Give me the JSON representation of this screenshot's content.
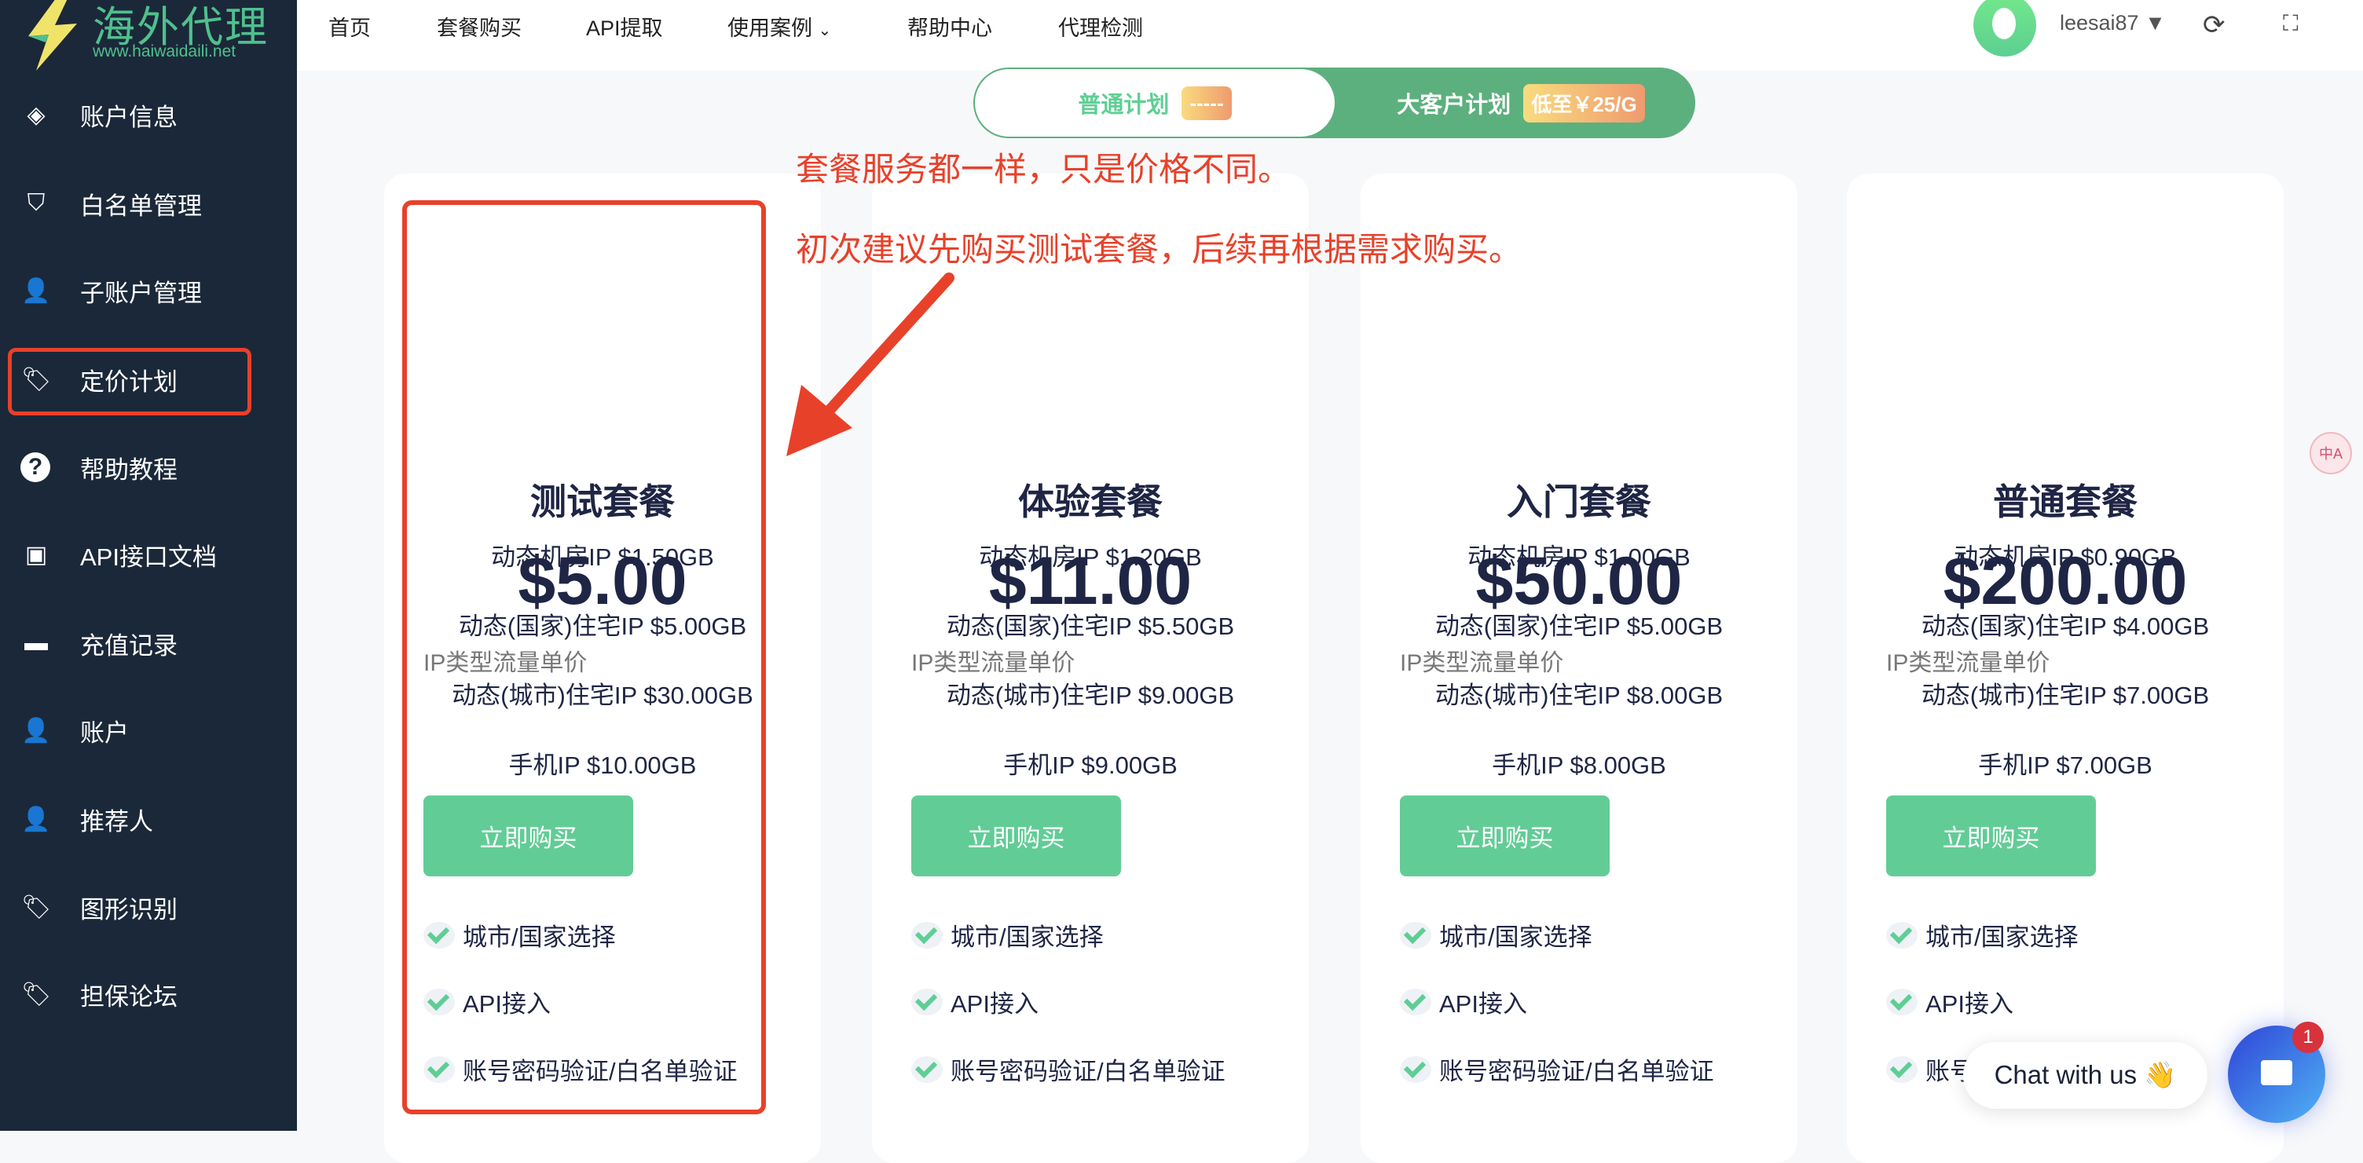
{
  "logo": {
    "name": "海外代理",
    "url": "www.haiwaidaili.net"
  },
  "nav": [
    "首页",
    "套餐购买",
    "API提取",
    "使用案例",
    "帮助中心",
    "代理检测"
  ],
  "user": {
    "name": "leesai87"
  },
  "sidebar": {
    "items": [
      {
        "label": "账户信息",
        "icon": "layers-icon"
      },
      {
        "label": "白名单管理",
        "icon": "shield-icon"
      },
      {
        "label": "子账户管理",
        "icon": "user-gear-icon"
      },
      {
        "label": "定价计划",
        "icon": "tag-icon"
      },
      {
        "label": "帮助教程",
        "icon": "question-icon"
      },
      {
        "label": "API接口文档",
        "icon": "cube-icon"
      },
      {
        "label": "充值记录",
        "icon": "wallet-icon"
      },
      {
        "label": "账户",
        "icon": "user-card-icon"
      },
      {
        "label": "推荐人",
        "icon": "user-share-icon"
      },
      {
        "label": "图形识别",
        "icon": "tag-icon"
      },
      {
        "label": "担保论坛",
        "icon": "tag-icon"
      }
    ],
    "active": 3
  },
  "plans_toggle": {
    "normal": "普通计划",
    "normal_tag": "-----",
    "enterprise": "大客户计划",
    "enterprise_tag": "低至￥25/G"
  },
  "annotations": [
    "套餐服务都一样，只是价格不同。",
    "初次建议先购买测试套餐，后续再根据需求购买。"
  ],
  "cards": [
    {
      "title": "测试套餐",
      "price": "$5.00",
      "subtitle": "IP类型流量单价",
      "lines": [
        "动态机房IP $1.50GB",
        "动态(国家)住宅IP $5.00GB",
        "动态(城市)住宅IP $30.00GB",
        "手机IP $10.00GB"
      ],
      "button": "立即购买",
      "features": [
        "城市/国家选择",
        "API接入",
        "账号密码验证/白名单验证"
      ]
    },
    {
      "title": "体验套餐",
      "price": "$11.00",
      "subtitle": "IP类型流量单价",
      "lines": [
        "动态机房IP $1.20GB",
        "动态(国家)住宅IP $5.50GB",
        "动态(城市)住宅IP $9.00GB",
        "手机IP $9.00GB"
      ],
      "button": "立即购买",
      "features": [
        "城市/国家选择",
        "API接入",
        "账号密码验证/白名单验证"
      ]
    },
    {
      "title": "入门套餐",
      "price": "$50.00",
      "subtitle": "IP类型流量单价",
      "lines": [
        "动态机房IP $1.00GB",
        "动态(国家)住宅IP $5.00GB",
        "动态(城市)住宅IP $8.00GB",
        "手机IP $8.00GB"
      ],
      "button": "立即购买",
      "features": [
        "城市/国家选择",
        "API接入",
        "账号密码验证/白名单验证"
      ]
    },
    {
      "title": "普通套餐",
      "price": "$200.00",
      "subtitle": "IP类型流量单价",
      "lines": [
        "动态机房IP $0.90GB",
        "动态(国家)住宅IP $4.00GB",
        "动态(城市)住宅IP $7.00GB",
        "手机IP $7.00GB"
      ],
      "button": "立即购买",
      "features": [
        "城市/国家选择",
        "API接入",
        "账号密码验证/白名单验证"
      ]
    }
  ],
  "chat": {
    "label": "Chat with us 👋",
    "badge": "1"
  },
  "translate_label": "中A"
}
